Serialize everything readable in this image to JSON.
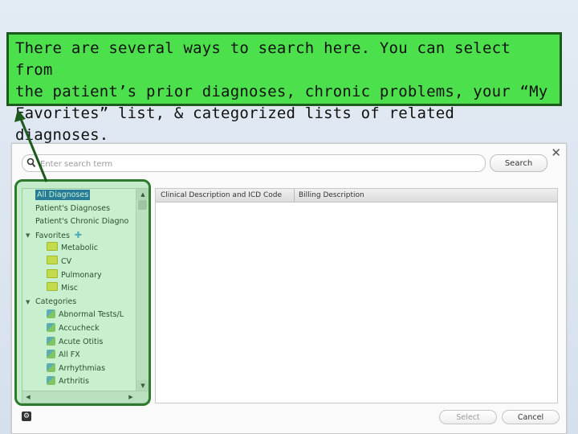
{
  "callout": {
    "line1": "There are several ways to search here.  You can select from",
    "line2": "the patient’s prior diagnoses, chronic problems, your “My",
    "line3": "Favorites” list, & categorized lists of related diagnoses."
  },
  "search": {
    "placeholder": "Enter search term",
    "button_label": "Search"
  },
  "close_icon": "close-icon",
  "tree": {
    "items": [
      {
        "label": "All Diagnoses",
        "selected": true
      },
      {
        "label": "Patient's Diagnoses"
      },
      {
        "label": "Patient's Chronic Diagno"
      },
      {
        "label": "Favorites",
        "expanded": true
      },
      {
        "label": "Metabolic",
        "icon": "folder-icon"
      },
      {
        "label": "CV",
        "icon": "folder-icon"
      },
      {
        "label": "Pulmonary",
        "icon": "folder-icon"
      },
      {
        "label": "Misc",
        "icon": "folder-icon"
      },
      {
        "label": "Categories",
        "expanded": true
      },
      {
        "label": "Abnormal Tests/L",
        "icon": "category-icon"
      },
      {
        "label": "Accucheck",
        "icon": "category-icon"
      },
      {
        "label": "Acute Otitis",
        "icon": "category-icon"
      },
      {
        "label": "All FX",
        "icon": "category-icon"
      },
      {
        "label": "Arrhythmias",
        "icon": "category-icon"
      },
      {
        "label": "Arthritis",
        "icon": "category-icon"
      }
    ]
  },
  "results": {
    "columns": [
      "Clinical Description and ICD Code",
      "Billing Description"
    ]
  },
  "footer": {
    "select_label": "Select",
    "cancel_label": "Cancel"
  },
  "colors": {
    "callout_bg": "#4de04d",
    "highlight": "#2d7a2d",
    "selection": "#1f5fb5"
  }
}
